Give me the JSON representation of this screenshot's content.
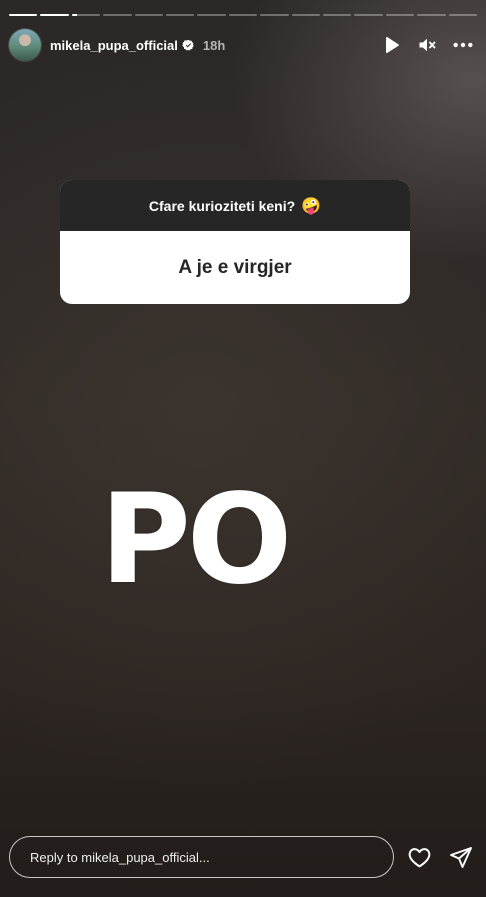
{
  "progress": {
    "segments": 15,
    "current_index": 2,
    "current_fraction": 0.2
  },
  "header": {
    "username": "mikela_pupa_official",
    "verified": true,
    "time": "18h",
    "controls": [
      "play-icon",
      "mute-icon",
      "more-icon"
    ]
  },
  "question": {
    "prompt": "Cfare kurioziteti keni?",
    "emoji": "🤪",
    "answer": "A je e virgjer"
  },
  "overlay_text": "PO",
  "footer": {
    "reply_placeholder": "Reply to mikela_pupa_official...",
    "actions": [
      "heart-icon",
      "send-icon"
    ]
  },
  "colors": {
    "background": "#2b2624",
    "question_header": "#262626",
    "text": "#ffffff"
  }
}
